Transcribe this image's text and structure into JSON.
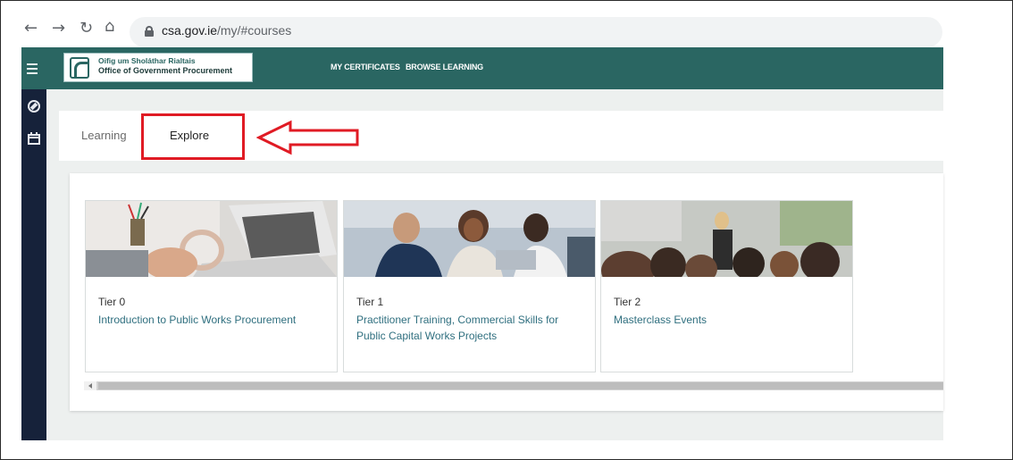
{
  "browser": {
    "url_host": "csa.gov.ie",
    "url_path": "/my/#courses",
    "back_icon": "arrow-left",
    "forward_icon": "arrow-right",
    "reload_icon": "reload",
    "home_icon": "home"
  },
  "header": {
    "logo_line1": "Oifig um Sholáthar Rialtais",
    "logo_line2": "Office of Government Procurement",
    "nav": [
      "MY CERTIFICATES",
      "BROWSE LEARNING"
    ],
    "color": "#2a6662"
  },
  "tabs": {
    "learning": "Learning",
    "explore": "Explore"
  },
  "annotation": {
    "box_color": "#e01b24"
  },
  "courses": [
    {
      "tier": "Tier 0",
      "title": "Introduction to Public Works Procurement"
    },
    {
      "tier": "Tier 1",
      "title": "Practitioner Training, Commercial Skills for Public Capital Works Projects"
    },
    {
      "tier": "Tier 2",
      "title": "Masterclass Events"
    }
  ]
}
